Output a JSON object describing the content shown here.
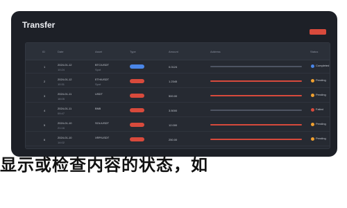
{
  "window": {
    "title": "Transfer"
  },
  "table": {
    "headers": [
      "ID",
      "Date",
      "Asset",
      "Type",
      "Amount",
      "Address",
      "Status"
    ],
    "rows": [
      {
        "id": "1",
        "date": "2024-01-12",
        "date_sub": "10:24",
        "asset": "BTC/USDT",
        "asset_sub": "Spot",
        "type": "blue",
        "amount": "0.0124",
        "address": "grey",
        "status": "Completed",
        "status_color": "#4a86e8"
      },
      {
        "id": "2",
        "date": "2024-01-12",
        "date_sub": "10:31",
        "asset": "ETH/USDT",
        "asset_sub": "Spot",
        "type": "red",
        "amount": "1.2345",
        "address": "red",
        "status": "Pending",
        "status_color": "#f0a030"
      },
      {
        "id": "3",
        "date": "2024-01-11",
        "date_sub": "18:05",
        "asset": "USDT",
        "asset_sub": "",
        "type": "red",
        "amount": "500.00",
        "address": "red",
        "status": "Pending",
        "status_color": "#f0a030"
      },
      {
        "id": "4",
        "date": "2024-01-11",
        "date_sub": "09:47",
        "asset": "BNB",
        "asset_sub": "",
        "type": "red",
        "amount": "3.5000",
        "address": "grey",
        "status": "Failed",
        "status_color": "#d84a3c"
      },
      {
        "id": "5",
        "date": "2024-01-10",
        "date_sub": "21:16",
        "asset": "SOL/USDT",
        "asset_sub": "",
        "type": "red",
        "amount": "12.000",
        "address": "red",
        "status": "Pending",
        "status_color": "#f0a030"
      },
      {
        "id": "6",
        "date": "2024-01-10",
        "date_sub": "14:02",
        "asset": "XRP/USDT",
        "asset_sub": "",
        "type": "red",
        "amount": "250.00",
        "address": "red",
        "status": "Pending",
        "status_color": "#f0a030"
      }
    ]
  },
  "banner": {
    "text": "显示或检查内容的状态，如"
  },
  "colors": {
    "accent": "#d84a3c",
    "blue": "#4a86e8",
    "orange": "#f0a030",
    "panel": "#1d2027"
  }
}
